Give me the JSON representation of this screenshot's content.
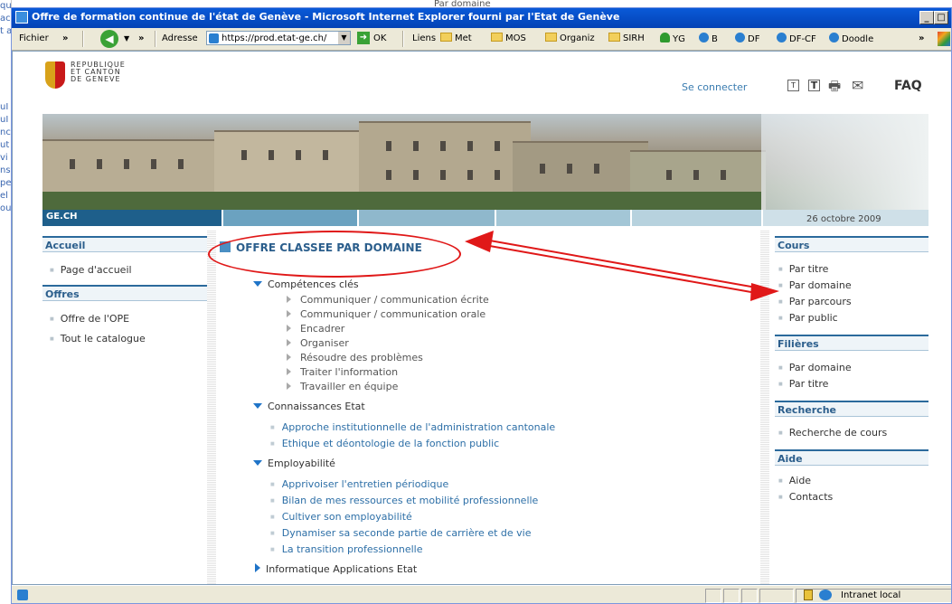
{
  "background": {
    "left_fragments": [
      "que",
      "ac",
      "t a",
      "",
      "",
      "",
      "",
      "",
      "uI",
      "uI",
      "nc",
      "ut",
      "vi",
      "ns",
      "pe",
      "el",
      "ou"
    ],
    "top_fragment": "Par domaine"
  },
  "window": {
    "title": "Offre de formation continue de l'état de Genève - Microsoft Internet Explorer fourni par l'Etat de Genève",
    "minimize": "_",
    "restore": "□"
  },
  "toolbar": {
    "menu_file": "Fichier",
    "chevron": "»",
    "back": "◀",
    "address_label": "Adresse",
    "address_value": "https://prod.etat-ge.ch/",
    "go_label": "OK",
    "links_label": "Liens",
    "links": [
      {
        "label": "Met",
        "icon": "folder-icon"
      },
      {
        "label": "MOS",
        "icon": "folder-icon"
      },
      {
        "label": "Organiz",
        "icon": "folder-icon"
      },
      {
        "label": "SIRH",
        "icon": "folder-icon"
      },
      {
        "label": "YG",
        "icon": "plant-icon"
      },
      {
        "label": "B",
        "icon": "ie-page-icon"
      },
      {
        "label": "DF",
        "icon": "ie-page-icon"
      },
      {
        "label": "DF-CF",
        "icon": "ie-page-icon"
      },
      {
        "label": "Doodle",
        "icon": "ie-page-icon"
      }
    ]
  },
  "header": {
    "logo_line1": "REPUBLIQUE",
    "logo_line2": "ET CANTON",
    "logo_line3": "DE GENEVE",
    "login": "Se connecter",
    "icon_text_small": "T",
    "icon_text_large": "T",
    "icon_print": "🖶",
    "icon_mail": "✉",
    "faq": "FAQ",
    "site_label": "GE.CH",
    "date": "26 octobre 2009"
  },
  "leftnav": {
    "sections": [
      {
        "title": "Accueil",
        "items": [
          "Page d'accueil"
        ]
      },
      {
        "title": "Offres",
        "items": [
          "Offre de l'OPE",
          "Tout le catalogue"
        ]
      }
    ]
  },
  "main": {
    "heading": "OFFRE CLASSEE PAR DOMAINE",
    "categories": [
      {
        "label": "Compétences clés",
        "expanded": true,
        "subs": [
          "Communiquer / communication écrite",
          "Communiquer / communication orale",
          "Encadrer",
          "Organiser",
          "Résoudre des problèmes",
          "Traiter l'information",
          "Travailler en équipe"
        ]
      },
      {
        "label": "Connaissances Etat",
        "expanded": true,
        "links": [
          "Approche institutionnelle de l'administration cantonale",
          "Ethique et déontologie de la fonction public"
        ]
      },
      {
        "label": "Employabilité",
        "expanded": true,
        "links": [
          "Apprivoiser l'entretien périodique",
          "Bilan de mes ressources et mobilité professionnelle",
          "Cultiver son employabilité",
          "Dynamiser sa seconde partie de carrière et de vie",
          "La transition professionnelle"
        ]
      },
      {
        "label": "Informatique Applications Etat",
        "expanded": false
      }
    ]
  },
  "rightnav": {
    "sections": [
      {
        "title": "Cours",
        "items": [
          "Par titre",
          "Par domaine",
          "Par parcours",
          "Par public"
        ]
      },
      {
        "title": "Filières",
        "items": [
          "Par domaine",
          "Par titre"
        ]
      },
      {
        "title": "Recherche",
        "items": [
          "Recherche de cours"
        ]
      },
      {
        "title": "Aide",
        "items": [
          "Aide",
          "Contacts"
        ]
      }
    ]
  },
  "annotation": {
    "color": "#e01818"
  },
  "statusbar": {
    "zone": "Intranet local"
  }
}
